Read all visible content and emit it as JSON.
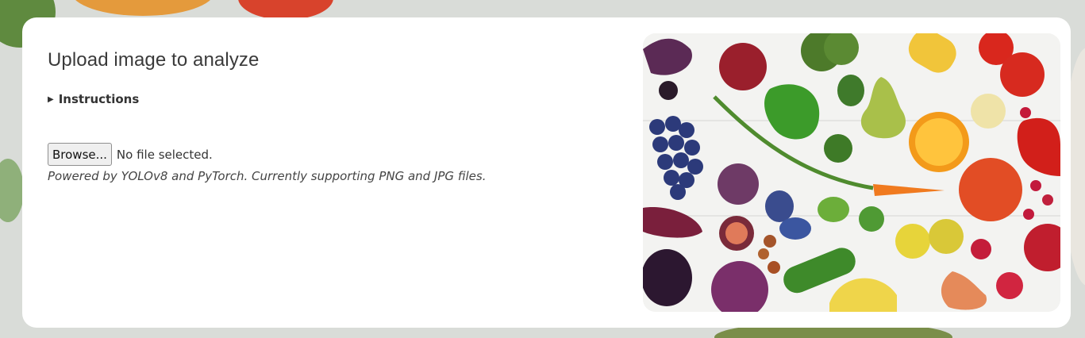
{
  "header": {
    "title": "Upload image to analyze"
  },
  "instructions": {
    "label": "Instructions",
    "icon": "triangle-right-icon"
  },
  "upload": {
    "browse_label": "Browse...",
    "status_text": "No file selected.",
    "caption": "Powered by YOLOv8 and PyTorch. Currently supporting PNG and JPG files."
  },
  "colors": {
    "card_bg": "#ffffff",
    "text_primary": "#3a3a3a",
    "page_bg": "#d9dcd8"
  }
}
